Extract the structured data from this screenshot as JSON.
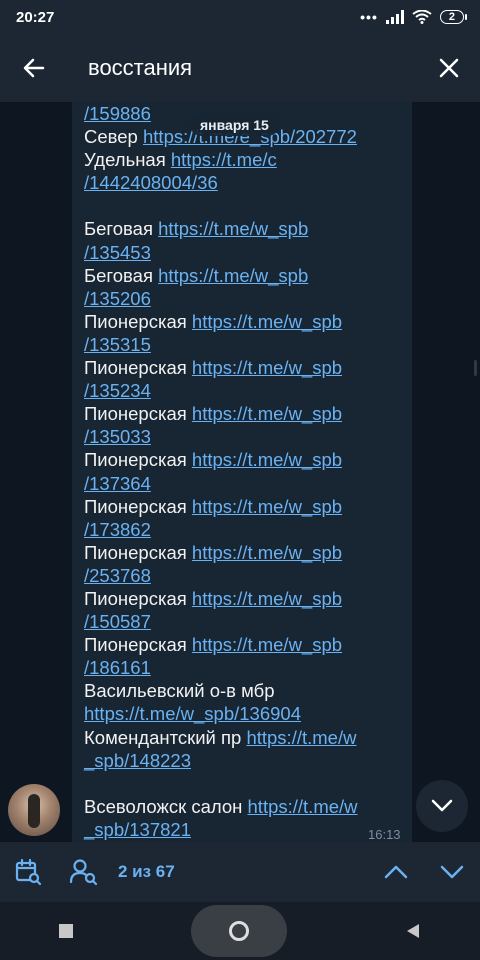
{
  "status_bar": {
    "time": "20:27",
    "dots": "•••",
    "battery": "2"
  },
  "search": {
    "query": "восстания"
  },
  "date_pill": "января 15",
  "message": {
    "lines": [
      {
        "text": "",
        "link": "/159886"
      },
      {
        "text": "Север ",
        "link": "https://t.me/e_spb/202772"
      },
      {
        "text": "Удельная ",
        "link": "https://t.me/c"
      },
      {
        "text": "",
        "link": "/1442408004/36"
      },
      {
        "spacer": true
      },
      {
        "text": "Беговая ",
        "link": "https://t.me/w_spb"
      },
      {
        "text": "",
        "link": "/135453"
      },
      {
        "text": "Беговая ",
        "link": "https://t.me/w_spb"
      },
      {
        "text": "",
        "link": "/135206"
      },
      {
        "text": "Пионерская ",
        "link": "https://t.me/w_spb"
      },
      {
        "text": "",
        "link": "/135315"
      },
      {
        "text": "Пионерская ",
        "link": "https://t.me/w_spb"
      },
      {
        "text": "",
        "link": "/135234"
      },
      {
        "text": "Пионерская ",
        "link": "https://t.me/w_spb"
      },
      {
        "text": "",
        "link": "/135033"
      },
      {
        "text": "Пионерская ",
        "link": "https://t.me/w_spb"
      },
      {
        "text": "",
        "link": "/137364"
      },
      {
        "text": "Пионерская ",
        "link": "https://t.me/w_spb"
      },
      {
        "text": "",
        "link": "/173862"
      },
      {
        "text": "Пионерская ",
        "link": "https://t.me/w_spb"
      },
      {
        "text": "",
        "link": "/253768"
      },
      {
        "text": "Пионерская ",
        "link": "https://t.me/w_spb"
      },
      {
        "text": "",
        "link": "/150587"
      },
      {
        "text": "Пионерская ",
        "link": "https://t.me/w_spb"
      },
      {
        "text": "",
        "link": "/186161"
      },
      {
        "text": "Васильевский о-в мбр",
        "link": ""
      },
      {
        "text": "",
        "link": "https://t.me/w_spb/136904"
      },
      {
        "text": "Комендантский пр ",
        "link": "https://t.me/w"
      },
      {
        "text": "",
        "link": "_spb/148223"
      },
      {
        "spacer": true
      },
      {
        "text": "Всеволожск салон ",
        "link": "https://t.me/w"
      },
      {
        "text": "",
        "link": "_spb/137821"
      }
    ],
    "time": "16:13"
  },
  "bottom_bar": {
    "counter": "2 из 67"
  },
  "colors": {
    "accent": "#6ab2f2",
    "header_bg": "#1c2733",
    "bubble_bg": "#182533",
    "chat_bg": "#0e1621"
  }
}
